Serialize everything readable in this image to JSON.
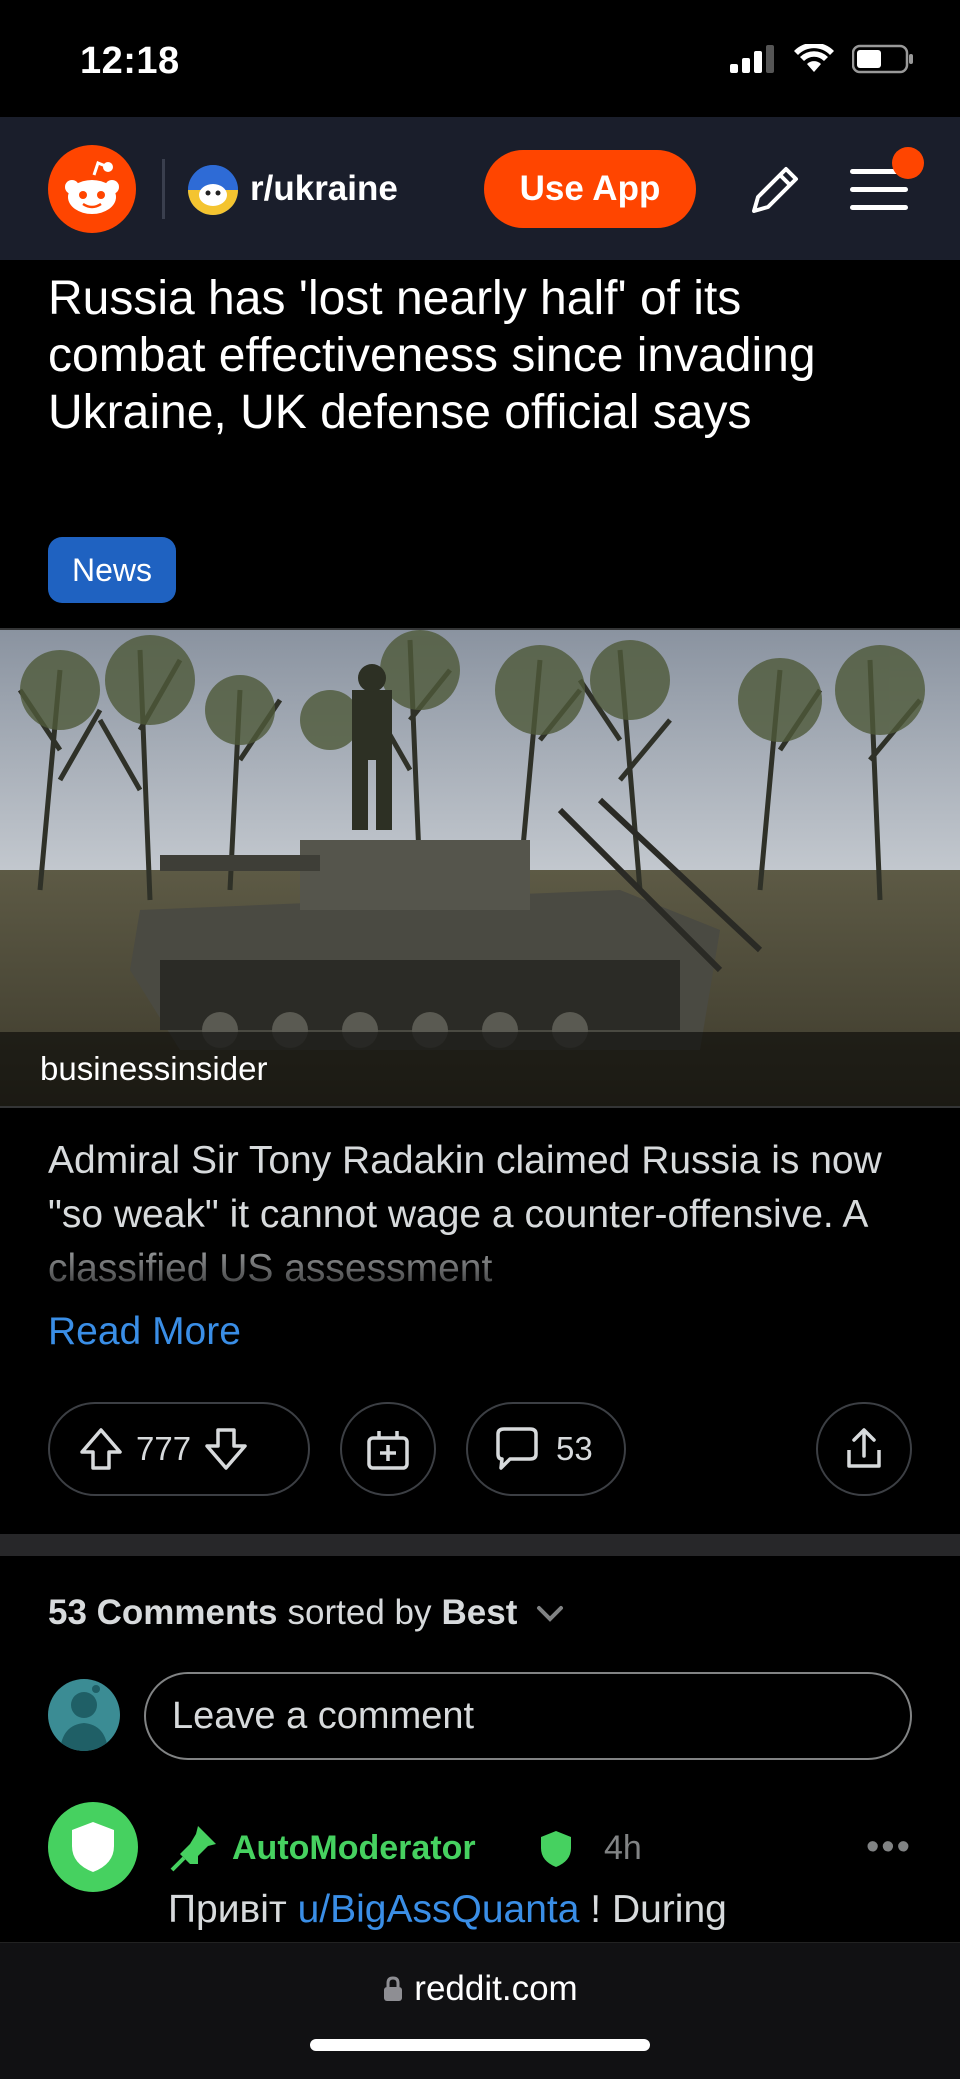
{
  "status_bar": {
    "time": "12:18"
  },
  "header": {
    "subreddit": "r/ukraine",
    "use_app_label": "Use App"
  },
  "post": {
    "title": "Russia has 'lost nearly half' of its combat effectiveness since invading Ukraine, UK defense official says",
    "flair": "News",
    "source": "businessinsider",
    "excerpt": "Admiral Sir Tony Radakin claimed Russia is now \"so weak\" it cannot wage a counter-offensive. A classified US assessment",
    "read_more": "Read More",
    "votes": "777",
    "comment_count": "53"
  },
  "comments": {
    "count_label": "53 Comments",
    "sorted_by_text": "sorted by",
    "sort_value": "Best",
    "input_placeholder": "Leave a comment",
    "first": {
      "author": "AutoModerator",
      "time": "4h",
      "text_before": "Привіт ",
      "mention": "u/BigAssQuanta",
      "text_after": " ! During"
    }
  },
  "browser": {
    "domain": "reddit.com"
  },
  "colors": {
    "accent": "#ff4500",
    "link": "#3a8ee6",
    "flair": "#1f62c1",
    "mod_green": "#46d160",
    "header_bg": "#1a1e2b"
  }
}
